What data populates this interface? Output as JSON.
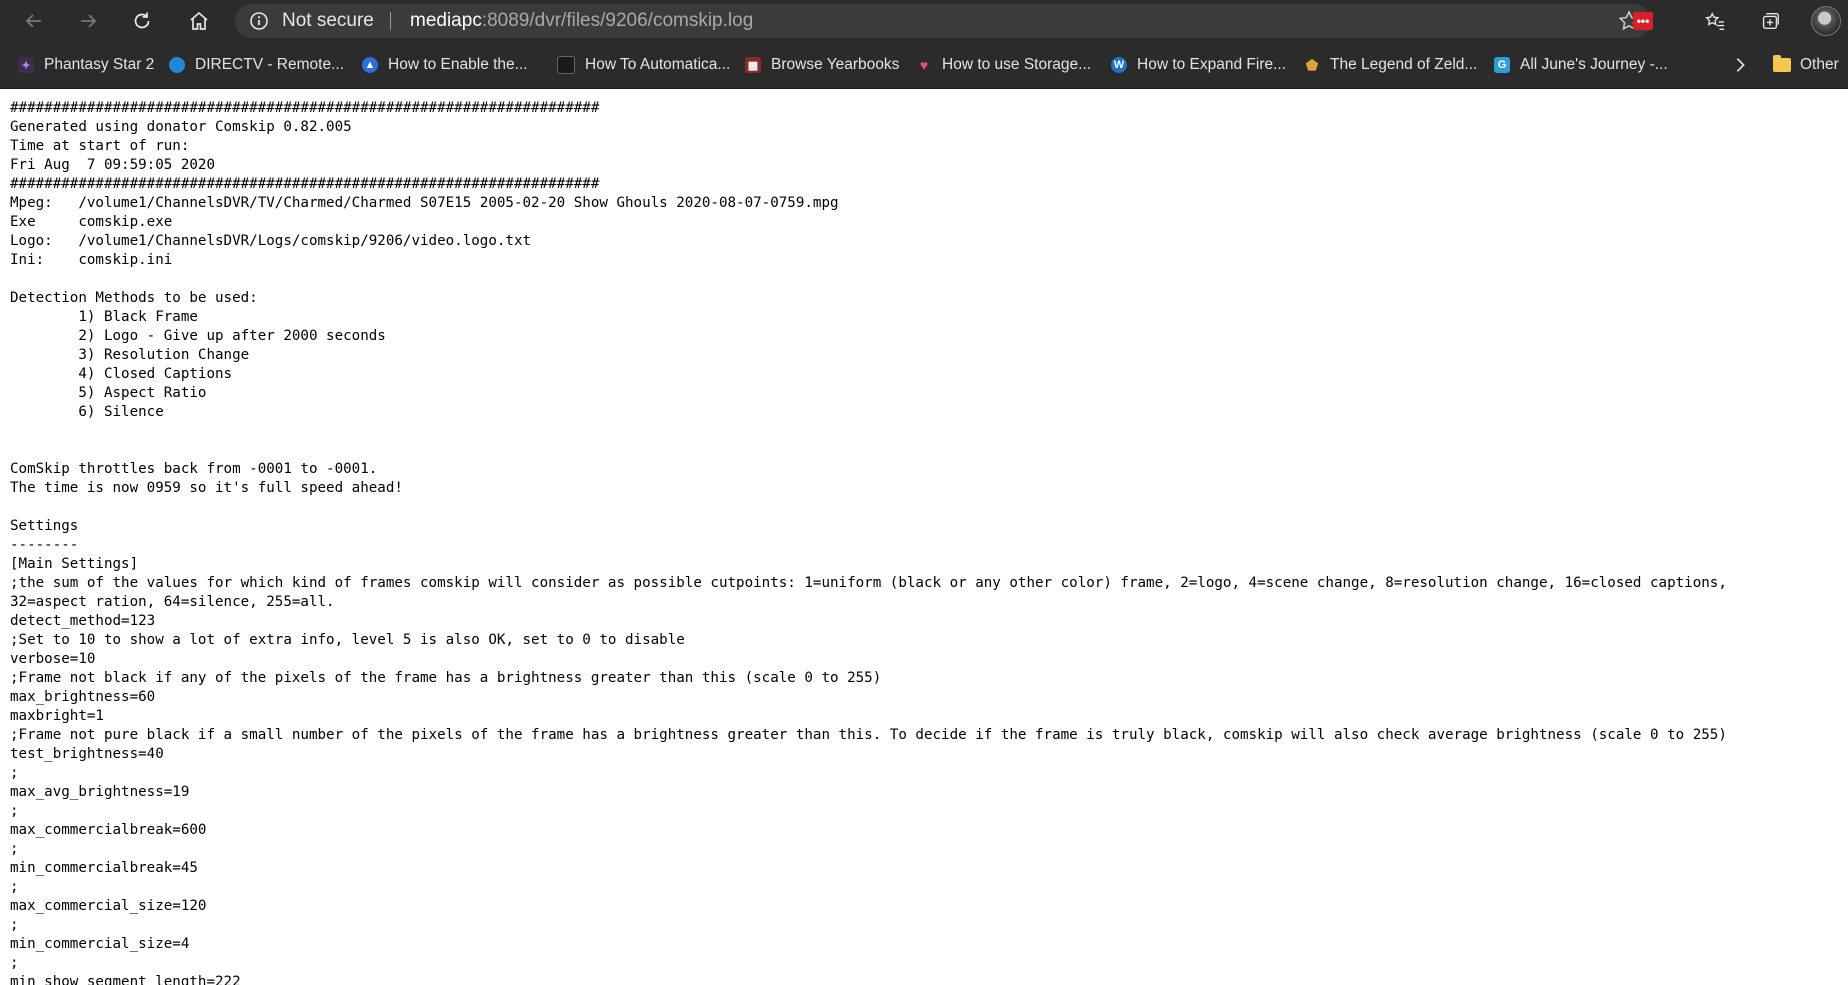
{
  "browser": {
    "security_label": "Not secure",
    "url_host": "mediapc",
    "url_path": ":8089/dvr/files/9206/comskip.log",
    "icons": {
      "back": "back-arrow-icon",
      "forward": "forward-arrow-icon",
      "refresh": "refresh-icon",
      "home": "home-icon",
      "info": "info-icon",
      "favorite": "star-icon",
      "extension": "lastpass-icon",
      "favorites_bar": "favorites-icon",
      "collections": "collections-icon",
      "profile": "avatar"
    },
    "extension_badge": "•••",
    "colors": {
      "toolbar": "#2b2b2b",
      "address_bar": "#3b3b3b",
      "extension": "#d81f26"
    }
  },
  "bookmarks": [
    {
      "label": "Phantasy Star 2",
      "icon": "phantasy-star-icon"
    },
    {
      "label": "DIRECTV - Remote...",
      "icon": "directv-globe-icon"
    },
    {
      "label": "How to Enable the...",
      "icon": "triangle-logo-icon"
    },
    {
      "label": "How To Automatica...",
      "icon": "dark-square-icon"
    },
    {
      "label": "Browse Yearbooks",
      "icon": "yearbook-icon"
    },
    {
      "label": "How to use Storage...",
      "icon": "heart-logo-icon"
    },
    {
      "label": "How to Expand Fire...",
      "icon": "w-logo-icon"
    },
    {
      "label": "The Legend of Zeld...",
      "icon": "zelda-shield-icon"
    },
    {
      "label": "All June's Journey -...",
      "icon": "g-logo-icon"
    }
  ],
  "bookmarks_more": "chevron-right-icon",
  "other_favorites": "Other",
  "log_lines": [
    "#####################################################################",
    "Generated using donator Comskip 0.82.005",
    "Time at start of run:",
    "Fri Aug  7 09:59:05 2020",
    "#####################################################################",
    "Mpeg:   /volume1/ChannelsDVR/TV/Charmed/Charmed S07E15 2005-02-20 Show Ghouls 2020-08-07-0759.mpg",
    "Exe     comskip.exe",
    "Logo:   /volume1/ChannelsDVR/Logs/comskip/9206/video.logo.txt",
    "Ini:    comskip.ini",
    "",
    "Detection Methods to be used:",
    "        1) Black Frame",
    "        2) Logo - Give up after 2000 seconds",
    "        3) Resolution Change",
    "        4) Closed Captions",
    "        5) Aspect Ratio",
    "        6) Silence",
    "",
    "",
    "ComSkip throttles back from -0001 to -0001.",
    "The time is now 0959 so it's full speed ahead!",
    "",
    "Settings",
    "--------",
    "[Main Settings]",
    ";the sum of the values for which kind of frames comskip will consider as possible cutpoints: 1=uniform (black or any other color) frame, 2=logo, 4=scene change, 8=resolution change, 16=closed captions,",
    "32=aspect ration, 64=silence, 255=all.",
    "detect_method=123",
    ";Set to 10 to show a lot of extra info, level 5 is also OK, set to 0 to disable",
    "verbose=10",
    ";Frame not black if any of the pixels of the frame has a brightness greater than this (scale 0 to 255)",
    "max_brightness=60",
    "maxbright=1",
    ";Frame not pure black if a small number of the pixels of the frame has a brightness greater than this. To decide if the frame is truly black, comskip will also check average brightness (scale 0 to 255)",
    "test_brightness=40",
    ";",
    "max_avg_brightness=19",
    ";",
    "max_commercialbreak=600",
    ";",
    "min_commercialbreak=45",
    ";",
    "max_commercial_size=120",
    ";",
    "min_commercial_size=4",
    ";",
    "min_show_segment_length=222"
  ]
}
